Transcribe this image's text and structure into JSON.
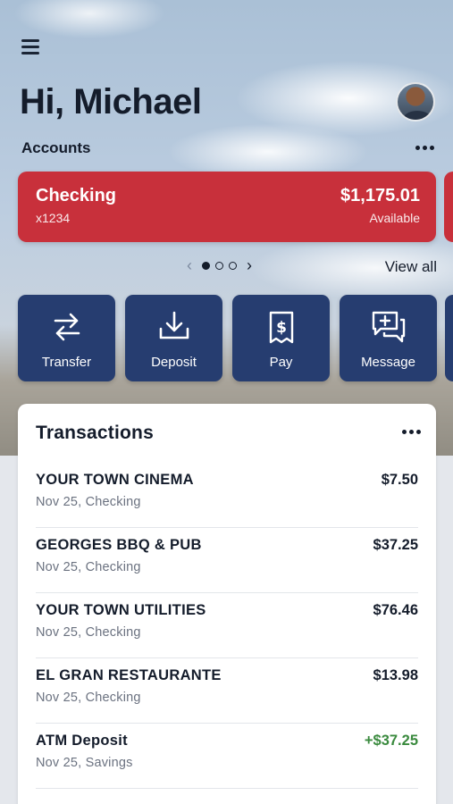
{
  "header": {
    "greeting": "Hi, Michael",
    "menu_icon": "hamburger-menu-icon",
    "avatar": "user-avatar"
  },
  "accounts": {
    "label": "Accounts",
    "more_icon": "more-dots-icon",
    "card": {
      "name": "Checking",
      "number": "x1234",
      "balance": "$1,175.01",
      "balance_label": "Available",
      "color": "#c8303b"
    },
    "pager": {
      "total_pages": 3,
      "active_page": 1
    },
    "view_all": "View all"
  },
  "quick_actions": [
    {
      "label": "Transfer",
      "icon": "transfer-arrows-icon"
    },
    {
      "label": "Deposit",
      "icon": "download-tray-icon"
    },
    {
      "label": "Pay",
      "icon": "dollar-receipt-icon"
    },
    {
      "label": "Message",
      "icon": "chat-plus-icon"
    }
  ],
  "transactions": {
    "title": "Transactions",
    "items": [
      {
        "merchant": "YOUR TOWN CINEMA",
        "meta": "Nov 25, Checking",
        "amount": "$7.50",
        "credit": false
      },
      {
        "merchant": "GEORGES BBQ & PUB",
        "meta": "Nov 25, Checking",
        "amount": "$37.25",
        "credit": false
      },
      {
        "merchant": "YOUR TOWN UTILITIES",
        "meta": "Nov 25, Checking",
        "amount": "$76.46",
        "credit": false
      },
      {
        "merchant": "EL GRAN RESTAURANTE",
        "meta": "Nov 25, Checking",
        "amount": "$13.98",
        "credit": false
      },
      {
        "merchant": "ATM Deposit",
        "meta": "Nov 25, Savings",
        "amount": "+$37.25",
        "credit": true
      }
    ]
  },
  "colors": {
    "accent_navy": "#263d70",
    "credit_green": "#3a8a3e",
    "card_red": "#c8303b"
  }
}
